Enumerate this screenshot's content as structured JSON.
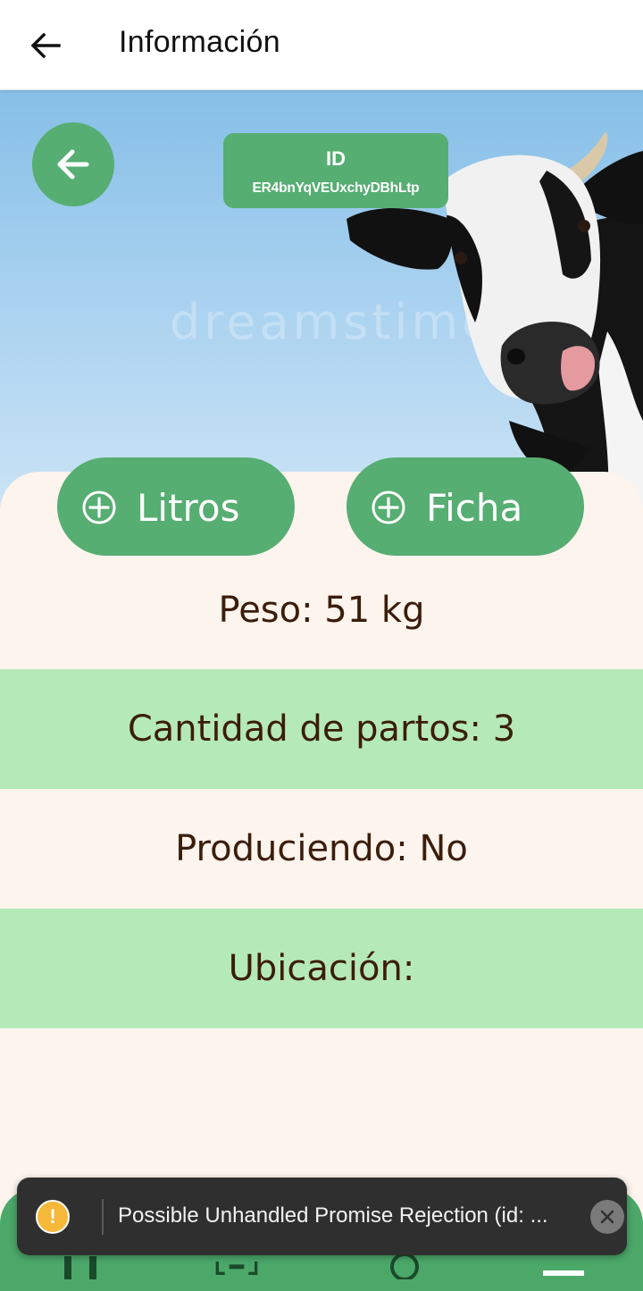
{
  "appbar": {
    "title": "Información",
    "back_icon": "arrow-left-icon"
  },
  "hero": {
    "watermark": "dreamstime",
    "back_icon": "arrow-left-icon",
    "id_title": "ID",
    "id_value": "ER4bnYqVEUxchyDBhLtp"
  },
  "actions": {
    "litros_label": "Litros",
    "ficha_label": "Ficha",
    "icon": "plus-circle-icon"
  },
  "info": {
    "peso": "Peso: 51 kg",
    "partos": "Cantidad de partos: 3",
    "produciendo": "Produciendo: No",
    "ubicacion": "Ubicación:"
  },
  "toast": {
    "message": "Possible Unhandled Promise Rejection (id: ...",
    "warning_symbol": "!",
    "close_icon": "close-icon"
  },
  "colors": {
    "primary_green": "#56ae72",
    "row_green": "#b5e9b8",
    "sheet_bg": "#fdf4ee",
    "text_brown": "#3b1d0a",
    "toast_bg": "#2f2f2f",
    "warning": "#f6b838"
  }
}
